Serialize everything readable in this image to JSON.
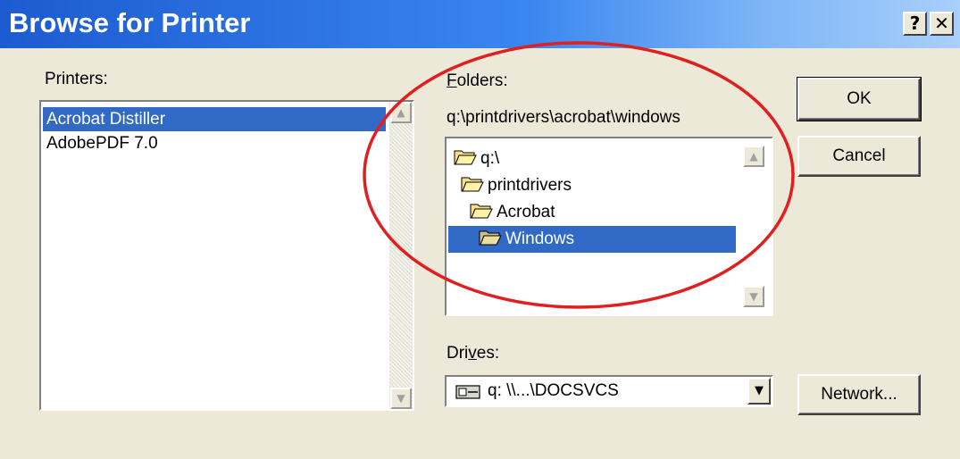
{
  "window": {
    "title": "Browse for Printer",
    "help_glyph": "?",
    "close_glyph": "✕"
  },
  "printers": {
    "label": "Printers:",
    "items": [
      {
        "label": "Acrobat Distiller",
        "selected": true
      },
      {
        "label": "AdobePDF 7.0",
        "selected": false
      }
    ]
  },
  "folders": {
    "label_accel": "F",
    "label_rest": "olders:",
    "current_path": "q:\\printdrivers\\acrobat\\windows",
    "tree": [
      {
        "label": "q:\\",
        "level": 0,
        "selected": false
      },
      {
        "label": "printdrivers",
        "level": 1,
        "selected": false
      },
      {
        "label": "Acrobat",
        "level": 2,
        "selected": false
      },
      {
        "label": "Windows",
        "level": 3,
        "selected": true
      }
    ]
  },
  "drives": {
    "label_pre": "Dri",
    "label_accel": "v",
    "label_post": "es:",
    "selected_value": "q: \\\\...\\DOCSVCS"
  },
  "buttons": {
    "ok": "OK",
    "cancel": "Cancel",
    "network": "Network..."
  },
  "icons": {
    "scroll_up": "▲",
    "scroll_down": "▼",
    "dropdown": "▼"
  },
  "colors": {
    "title_gradient_start": "#1c5bd0",
    "selection": "#3169c6",
    "highlight_ellipse": "#e02020"
  }
}
